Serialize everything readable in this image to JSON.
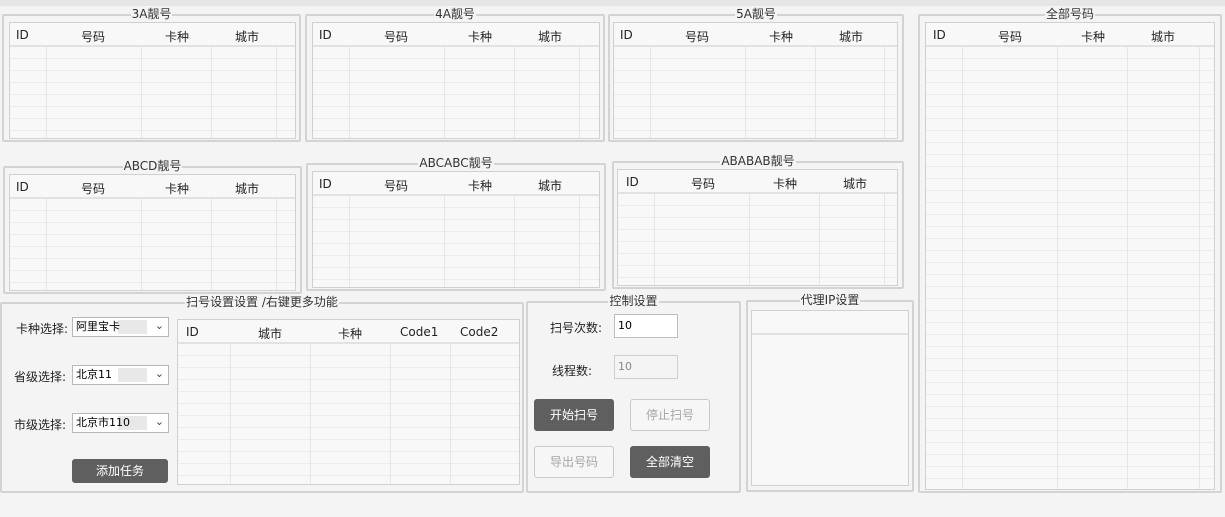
{
  "panels": {
    "p3a": {
      "title": "3A靓号",
      "columns": [
        "ID",
        "号码",
        "卡种",
        "城市"
      ]
    },
    "p4a": {
      "title": "4A靓号",
      "columns": [
        "ID",
        "号码",
        "卡种",
        "城市"
      ]
    },
    "p5a": {
      "title": "5A靓号",
      "columns": [
        "ID",
        "号码",
        "卡种",
        "城市"
      ]
    },
    "pabcd": {
      "title": "ABCD靓号",
      "columns": [
        "ID",
        "号码",
        "卡种",
        "城市"
      ]
    },
    "pabcabc": {
      "title": "ABCABC靓号",
      "columns": [
        "ID",
        "号码",
        "卡种",
        "城市"
      ]
    },
    "pababab": {
      "title": "ABABAB靓号",
      "columns": [
        "ID",
        "号码",
        "卡种",
        "城市"
      ]
    },
    "pall": {
      "title": "全部号码",
      "columns": [
        "ID",
        "号码",
        "卡种",
        "城市"
      ]
    }
  },
  "scan_settings": {
    "title": "扫号设置设置 /右键更多功能",
    "card_label": "卡种选择:",
    "card_value": "阿里宝卡",
    "province_label": "省级选择:",
    "province_value": "北京11",
    "city_label": "市级选择:",
    "city_value": "北京市110",
    "add_task": "添加任务",
    "task_columns": [
      "ID",
      "城市",
      "卡种",
      "Code1",
      "Code2"
    ]
  },
  "control": {
    "title": "控制设置",
    "scan_count_label": "扫号次数:",
    "scan_count_value": "10",
    "threads_label": "线程数:",
    "threads_value": "10",
    "start": "开始扫号",
    "stop": "停止扫号",
    "export": "导出号码",
    "clear_all": "全部清空"
  },
  "proxy": {
    "title": "代理IP设置"
  }
}
